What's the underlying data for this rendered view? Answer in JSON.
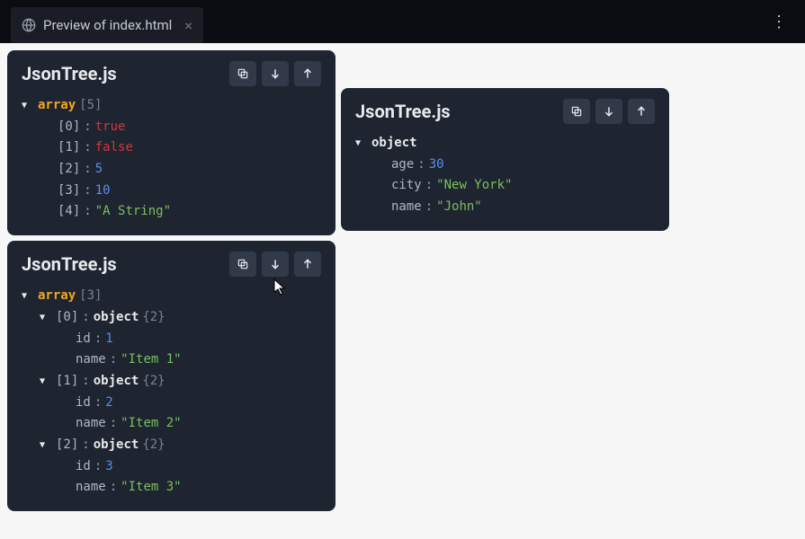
{
  "titlebar": {
    "tab_title": "Preview of index.html",
    "close_label": "×",
    "menu_label": "⋮"
  },
  "panels": {
    "panel1": {
      "title": "JsonTree.js",
      "root_key": "array",
      "root_count": "[5]",
      "items": [
        {
          "idx": "[0]",
          "type": "bool",
          "value": "true"
        },
        {
          "idx": "[1]",
          "type": "bool",
          "value": "false"
        },
        {
          "idx": "[2]",
          "type": "num",
          "value": "5"
        },
        {
          "idx": "[3]",
          "type": "num",
          "value": "10"
        },
        {
          "idx": "[4]",
          "type": "str",
          "value": "\"A String\""
        }
      ]
    },
    "panel2": {
      "title": "JsonTree.js",
      "root_key": "object",
      "props": [
        {
          "key": "age",
          "type": "num",
          "value": "30"
        },
        {
          "key": "city",
          "type": "str",
          "value": "\"New York\""
        },
        {
          "key": "name",
          "type": "str",
          "value": "\"John\""
        }
      ]
    },
    "panel3": {
      "title": "JsonTree.js",
      "root_key": "array",
      "root_count": "[3]",
      "items": [
        {
          "idx": "[0]",
          "type_label": "object",
          "count": "{2}",
          "props": [
            {
              "key": "id",
              "type": "num",
              "value": "1"
            },
            {
              "key": "name",
              "type": "str",
              "value": "\"Item 1\""
            }
          ]
        },
        {
          "idx": "[1]",
          "type_label": "object",
          "count": "{2}",
          "props": [
            {
              "key": "id",
              "type": "num",
              "value": "2"
            },
            {
              "key": "name",
              "type": "str",
              "value": "\"Item 2\""
            }
          ]
        },
        {
          "idx": "[2]",
          "type_label": "object",
          "count": "{2}",
          "props": [
            {
              "key": "id",
              "type": "num",
              "value": "3"
            },
            {
              "key": "name",
              "type": "str",
              "value": "\"Item 3\""
            }
          ]
        }
      ]
    }
  },
  "labels": {
    "colon": " : "
  }
}
